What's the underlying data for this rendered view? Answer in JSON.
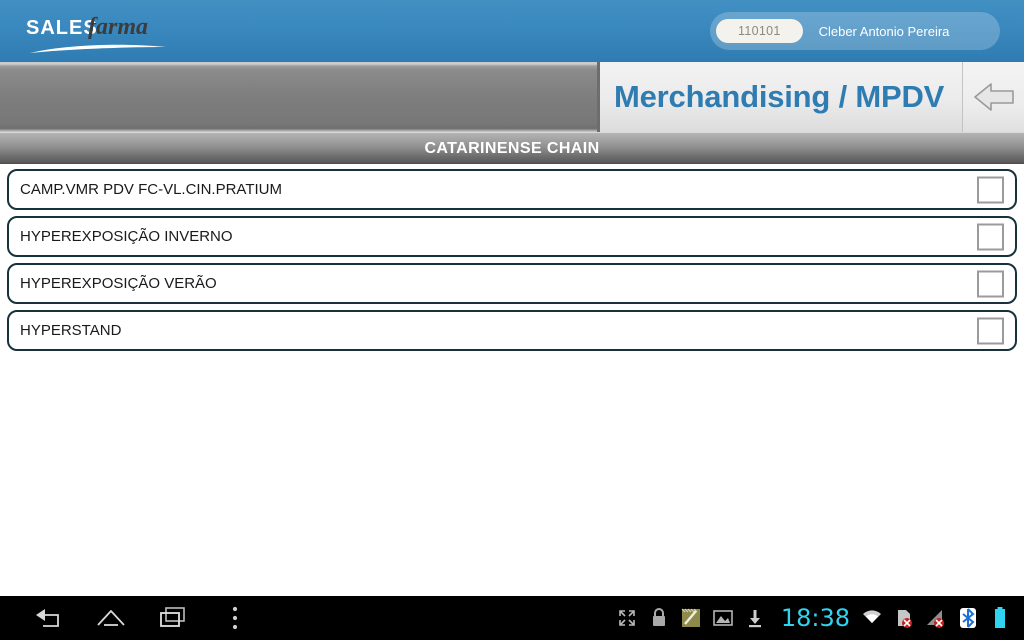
{
  "app": {
    "logo_primary": "SALES",
    "logo_secondary": "farma",
    "logo_icon": "salesfarma-logo"
  },
  "header": {
    "user_id": "110101",
    "user_name": "Cleber Antonio Pereira"
  },
  "title_bar": {
    "title": "Merchandising / MPDV",
    "back_icon": "back-arrow-icon"
  },
  "section": {
    "title": "CATARINENSE CHAIN"
  },
  "list": {
    "items": [
      {
        "label": "CAMP.VMR PDV FC-VL.CIN.PRATIUM",
        "checked": false
      },
      {
        "label": "HYPEREXPOSIÇÃO INVERNO",
        "checked": false
      },
      {
        "label": "HYPEREXPOSIÇÃO VERÃO",
        "checked": false
      },
      {
        "label": "HYPERSTAND",
        "checked": false
      }
    ]
  },
  "navbar": {
    "buttons": [
      {
        "icon": "back-icon",
        "label": "Back"
      },
      {
        "icon": "home-icon",
        "label": "Home"
      },
      {
        "icon": "recent-apps-icon",
        "label": "Recent apps"
      },
      {
        "icon": "overflow-menu-icon",
        "label": "Menu"
      }
    ],
    "status": {
      "clock": "18:38",
      "icons": [
        "fullscreen-icon",
        "lock-icon",
        "notepad-icon",
        "image-icon",
        "download-icon",
        "wifi-icon",
        "sim-card-off-icon",
        "signal-off-icon",
        "bluetooth-icon",
        "battery-icon"
      ]
    }
  },
  "colors": {
    "header_blue": "#3b8ac0",
    "title_blue": "#2f7cb2",
    "item_border": "#17323d",
    "clock_cyan": "#2fd4f0",
    "battery_cyan": "#2fd4f0"
  }
}
